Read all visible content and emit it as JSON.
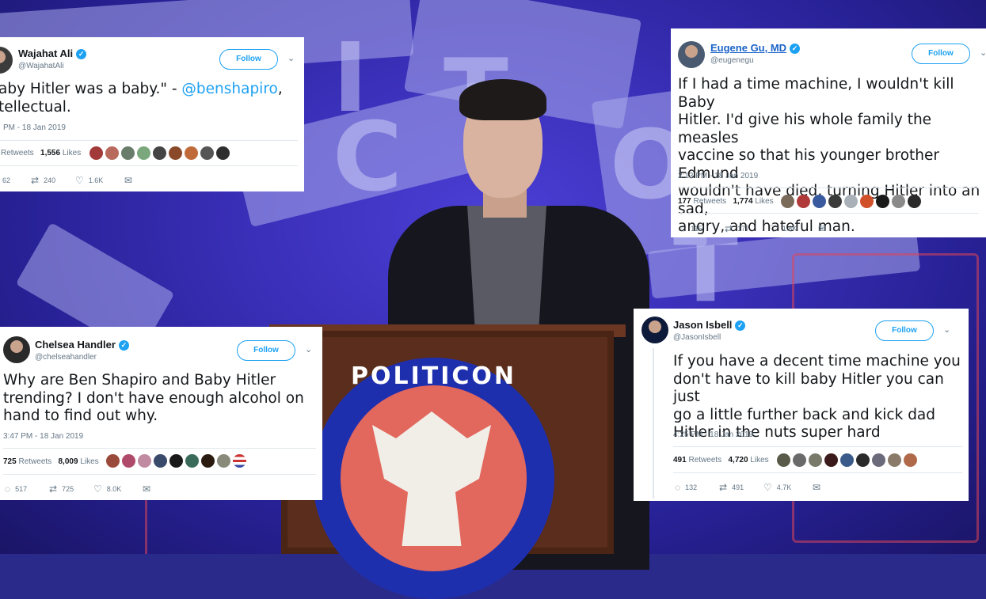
{
  "tweets": [
    {
      "id": "wajahat",
      "name": "Wajahat Ali",
      "handle": "@WajahatAli",
      "follow_label": "Follow",
      "text_before": "aby Hitler was a baby.\" - ",
      "mention": "@benshapiro",
      "text_after": ",\ntellectual.",
      "time": "PM - 18 Jan 2019",
      "retweets_label": "Retweets",
      "likes_count": "1,556",
      "likes_label": "Likes",
      "reply_count": "62",
      "retweet_count": "240",
      "like_count": "1.6K"
    },
    {
      "id": "eugene",
      "name": "Eugene Gu, MD",
      "handle": "@eugenegu",
      "follow_label": "Follow",
      "text": "If I had a time machine, I wouldn't kill Baby\nHitler. I'd give his whole family the measles\nvaccine so that his younger brother Edmund\nwouldn't have died, turning Hitler into an sad,\nangry, and hateful man.",
      "time": "2:13 PM - 18 Jan 2019",
      "retweets_count": "177",
      "retweets_label": "Retweets",
      "likes_count": "1,774",
      "likes_label": "Likes",
      "reply_count": "115",
      "retweet_count": "177",
      "like_count": "1.8K"
    },
    {
      "id": "chelsea",
      "name": "Chelsea Handler",
      "handle": "@chelseahandler",
      "follow_label": "Follow",
      "text": "Why are Ben Shapiro and Baby Hitler\ntrending? I don't have enough alcohol on\nhand to find out why.",
      "time": "3:47 PM - 18 Jan 2019",
      "retweets_count": "725",
      "retweets_label": "Retweets",
      "likes_count": "8,009",
      "likes_label": "Likes",
      "reply_count": "517",
      "retweet_count": "725",
      "like_count": "8.0K"
    },
    {
      "id": "jason",
      "name": "Jason Isbell",
      "handle": "@JasonIsbell",
      "follow_label": "Follow",
      "text": "If you have a decent time machine you\ndon't have to kill baby Hitler you can just\ngo a little further back and kick dad\nHitler in the nuts super hard",
      "time": "4:25 PM - 18 Jan 2019",
      "retweets_count": "491",
      "retweets_label": "Retweets",
      "likes_count": "4,720",
      "likes_label": "Likes",
      "reply_count": "132",
      "retweet_count": "491",
      "like_count": "4.7K"
    }
  ],
  "background": {
    "podium_seal_text": "POLITICON"
  },
  "colors": {
    "accent": "#1da1f2",
    "text": "#14171a",
    "muted": "#657786",
    "stage_purple": "#3a2fb8"
  },
  "icons": {
    "verified": "verified-badge-icon",
    "chevron": "chevron-down-icon",
    "reply": "reply-icon",
    "retweet": "retweet-icon",
    "like": "heart-icon",
    "dm": "envelope-icon"
  }
}
